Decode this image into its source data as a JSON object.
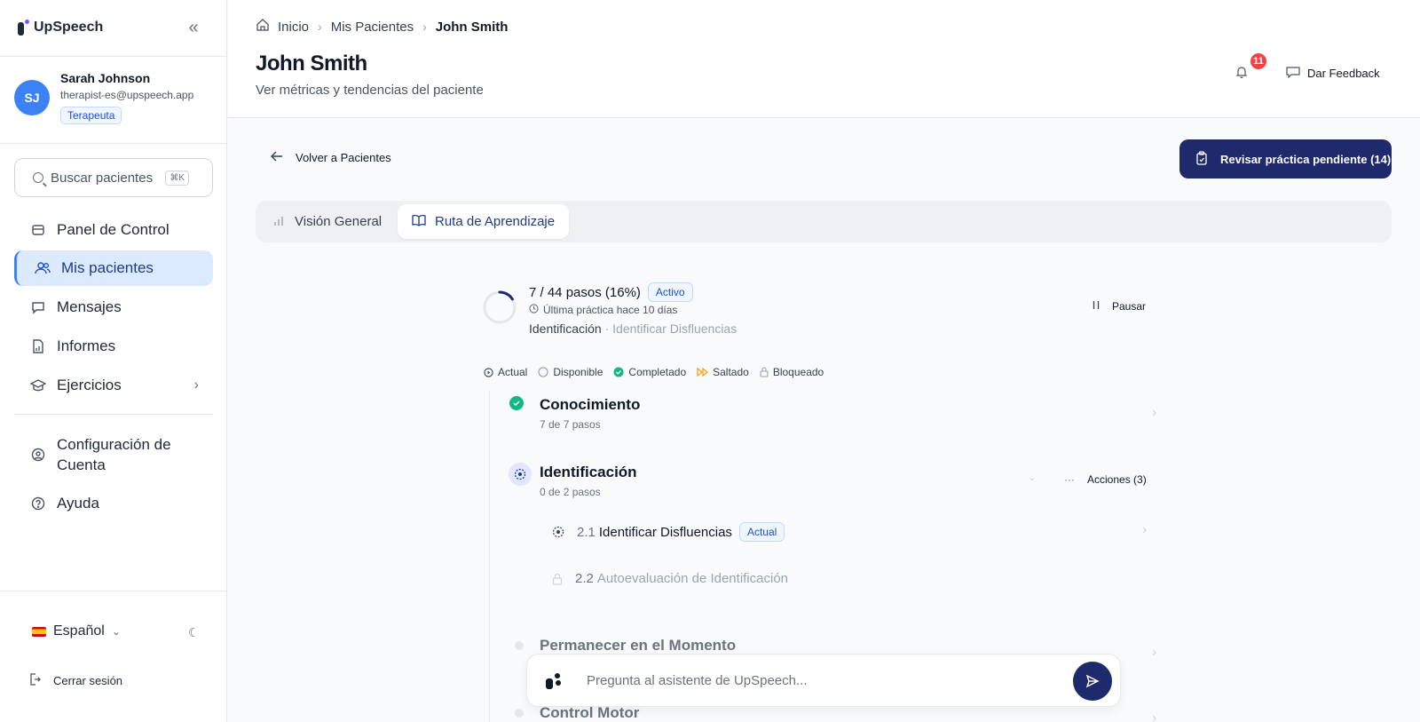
{
  "brand": {
    "name": "UpSpeech"
  },
  "user": {
    "initials": "SJ",
    "name": "Sarah Johnson",
    "email": "therapist-es@upspeech.app",
    "role": "Terapeuta"
  },
  "search": {
    "placeholder": "Buscar pacientes",
    "shortcut": "⌘K"
  },
  "nav": {
    "dashboard": "Panel de Control",
    "patients": "Mis pacientes",
    "messages": "Mensajes",
    "reports": "Informes",
    "exercises": "Ejercicios",
    "account": "Configuración de Cuenta",
    "help": "Ayuda"
  },
  "language": "Español",
  "logout": "Cerrar sesión",
  "breadcrumb": [
    "Inicio",
    "Mis Pacientes",
    "John Smith"
  ],
  "header": {
    "title": "John Smith",
    "subtitle": "Ver métricas y tendencias del paciente",
    "notifications": "11",
    "feedback": "Dar Feedback"
  },
  "back": "Volver a Pacientes",
  "review_button": "Revisar práctica pendiente (14)",
  "tabs": [
    "Visión General",
    "Ruta de Aprendizaje"
  ],
  "progress": {
    "summary": "7 / 44 pasos (16%)",
    "fraction": 0.16,
    "status": "Activo",
    "last_practice": "Última práctica hace 10 días",
    "current_module": "Identificación",
    "current_step": "· Identificar Disfluencias",
    "pause": "Pausar"
  },
  "legend": [
    "Actual",
    "Disponible",
    "Completado",
    "Saltado",
    "Bloqueado"
  ],
  "modules": {
    "m1": {
      "title": "Conocimiento",
      "sub": "7 de 7 pasos"
    },
    "m2": {
      "title": "Identificación",
      "sub": "0 de 2 pasos",
      "actions": "Acciones (3)"
    },
    "m3": {
      "title": "Permanecer en el Momento"
    },
    "m4": {
      "title": "Control Motor"
    }
  },
  "steps": {
    "s1": {
      "num": "2.1",
      "label": "Identificar Disfluencias",
      "badge": "Actual"
    },
    "s2": {
      "num": "2.2",
      "label": "Autoevaluación de Identificación"
    }
  },
  "assistant": {
    "placeholder": "Pregunta al asistente de UpSpeech..."
  },
  "colors": {
    "primary": "#1e2a6b",
    "accent": "#3b82f6",
    "success": "#10b981",
    "danger": "#ef4444",
    "skipped": "#f59e0b"
  }
}
